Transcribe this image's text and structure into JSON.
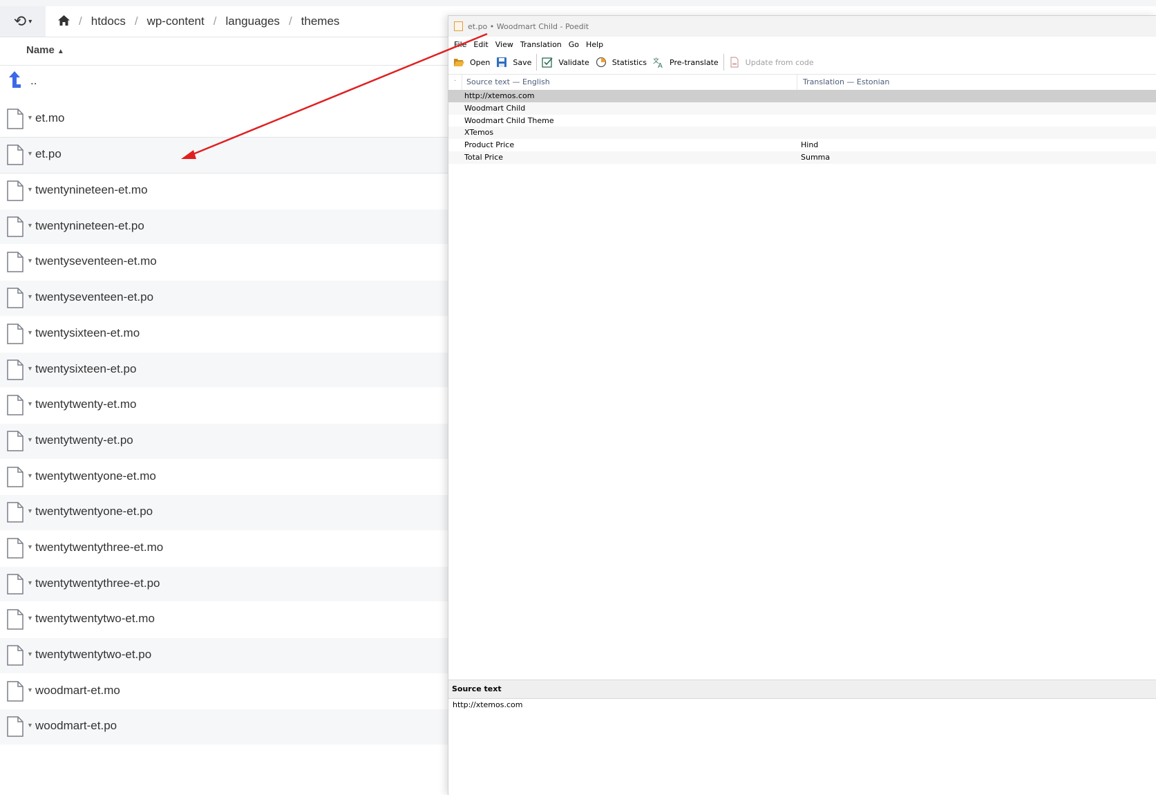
{
  "file_manager": {
    "breadcrumb": [
      "htdocs",
      "wp-content",
      "languages",
      "themes"
    ],
    "breadcrumb_separator": "/",
    "column_name": "Name",
    "sort_indicator": "▲",
    "parent_label": "..",
    "files": [
      "et.mo",
      "et.po",
      "twentynineteen-et.mo",
      "twentynineteen-et.po",
      "twentyseventeen-et.mo",
      "twentyseventeen-et.po",
      "twentysixteen-et.mo",
      "twentysixteen-et.po",
      "twentytwenty-et.mo",
      "twentytwenty-et.po",
      "twentytwentyone-et.mo",
      "twentytwentyone-et.po",
      "twentytwentythree-et.mo",
      "twentytwentythree-et.po",
      "twentytwentytwo-et.mo",
      "twentytwentytwo-et.po",
      "woodmart-et.mo",
      "woodmart-et.po"
    ]
  },
  "poedit": {
    "title": "et.po • Woodmart Child - Poedit",
    "menu": [
      "File",
      "Edit",
      "View",
      "Translation",
      "Go",
      "Help"
    ],
    "toolbar": {
      "open": "Open",
      "save": "Save",
      "validate": "Validate",
      "statistics": "Statistics",
      "pretranslate": "Pre-translate",
      "update": "Update from code"
    },
    "columns": {
      "dot": "·",
      "source": "Source text — English",
      "translation": "Translation — Estonian"
    },
    "entries": [
      {
        "source": "http://xtemos.com",
        "translation": ""
      },
      {
        "source": "Woodmart Child",
        "translation": ""
      },
      {
        "source": "Woodmart Child Theme",
        "translation": ""
      },
      {
        "source": "XTemos",
        "translation": ""
      },
      {
        "source": "Product Price",
        "translation": "Hind"
      },
      {
        "source": "Total Price",
        "translation": "Summa"
      }
    ],
    "source_panel_title": "Source text",
    "source_panel_text": "http://xtemos.com"
  },
  "colors": {
    "annotation_arrow": "#e02020",
    "accent_blue": "#3b6ae6",
    "selected_entry": "#cecece"
  }
}
